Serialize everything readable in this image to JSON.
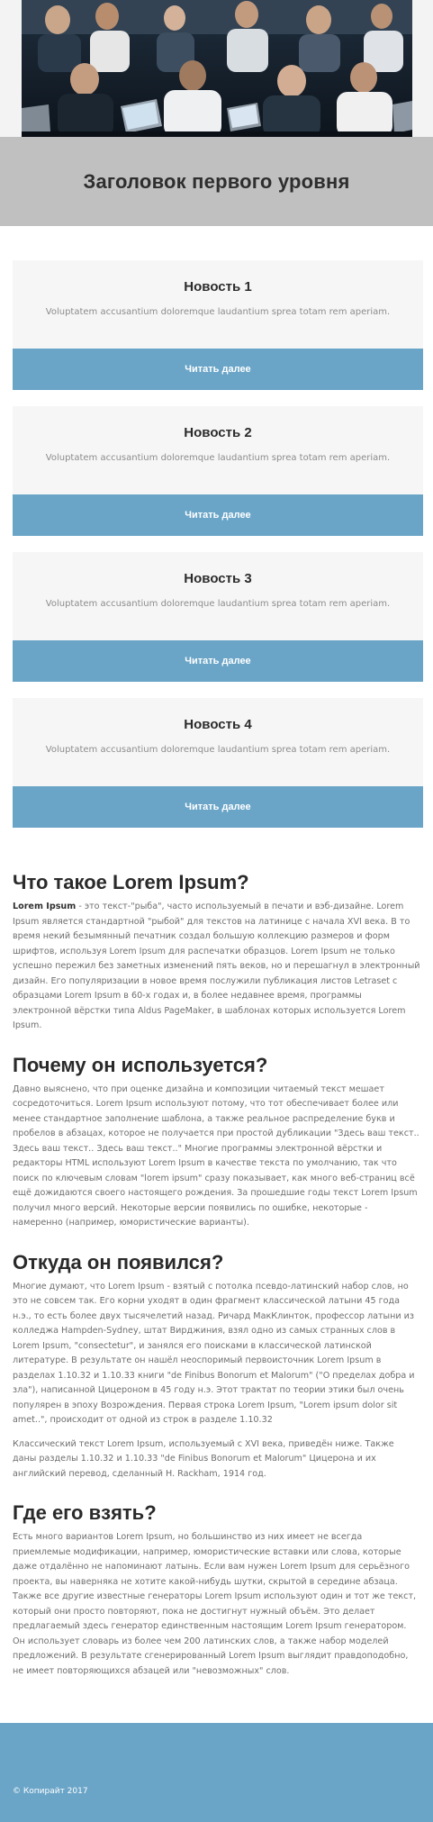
{
  "hero": {
    "image": "office-meeting-photo",
    "title": "Заголовок первого уровня"
  },
  "news": [
    {
      "title": "Новость 1",
      "text": "Voluptatem accusantium doloremque laudantium sprea totam rem aperiam.",
      "button": "Читать далее"
    },
    {
      "title": "Новость 2",
      "text": "Voluptatem accusantium doloremque laudantium sprea totam rem aperiam.",
      "button": "Читать далее"
    },
    {
      "title": "Новость 3",
      "text": "Voluptatem accusantium doloremque laudantium sprea totam rem aperiam.",
      "button": "Читать далее"
    },
    {
      "title": "Новость 4",
      "text": "Voluptatem accusantium doloremque laudantium sprea totam rem aperiam.",
      "button": "Читать далее"
    }
  ],
  "article": {
    "s1": {
      "heading": "Что такое Lorem Ipsum?",
      "lead": "Lorem Ipsum",
      "text": " - это текст-\"рыба\", часто используемый в печати и вэб-дизайне. Lorem Ipsum является стандартной \"рыбой\" для текстов на латинице с начала XVI века. В то время некий безымянный печатник создал большую коллекцию размеров и форм шрифтов, используя Lorem Ipsum для распечатки образцов. Lorem Ipsum не только успешно пережил без заметных изменений пять веков, но и перешагнул в электронный дизайн. Его популяризации в новое время послужили публикация листов Letraset с образцами Lorem Ipsum в 60-х годах и, в более недавнее время, программы электронной вёрстки типа Aldus PageMaker, в шаблонах которых используется Lorem Ipsum."
    },
    "s2": {
      "heading": "Почему он используется?",
      "text": "Давно выяснено, что при оценке дизайна и композиции читаемый текст мешает сосредоточиться. Lorem Ipsum используют потому, что тот обеспечивает более или менее стандартное заполнение шаблона, а также реальное распределение букв и пробелов в абзацах, которое не получается при простой дубликации \"Здесь ваш текст.. Здесь ваш текст.. Здесь ваш текст..\" Многие программы электронной вёрстки и редакторы HTML используют Lorem Ipsum в качестве текста по умолчанию, так что поиск по ключевым словам \"lorem ipsum\" сразу показывает, как много веб-страниц всё ещё дожидаются своего настоящего рождения. За прошедшие годы текст Lorem Ipsum получил много версий. Некоторые версии появились по ошибке, некоторые - намеренно (например, юмористические варианты)."
    },
    "s3": {
      "heading": "Откуда он появился?",
      "text": "Многие думают, что Lorem Ipsum - взятый с потолка псевдо-латинский набор слов, но это не совсем так. Его корни уходят в один фрагмент классической латыни 45 года н.э., то есть более двух тысячелетий назад. Ричард МакКлинток, профессор латыни из колледжа Hampden-Sydney, штат Вирджиния, взял одно из самых странных слов в Lorem Ipsum, \"consectetur\", и занялся его поисками в классической латинской литературе. В результате он нашёл неоспоримый первоисточник Lorem Ipsum в разделах 1.10.32 и 1.10.33 книги \"de Finibus Bonorum et Malorum\" (\"О пределах добра и зла\"), написанной Цицероном в 45 году н.э. Этот трактат по теории этики был очень популярен в эпоху Возрождения. Первая строка Lorem Ipsum, \"Lorem ipsum dolor sit amet..\", происходит от одной из строк в разделе 1.10.32",
      "text2": "Классический текст Lorem Ipsum, используемый с XVI века, приведён ниже. Также даны разделы 1.10.32 и 1.10.33 \"de Finibus Bonorum et Malorum\" Цицерона и их английский перевод, сделанный H. Rackham, 1914 год."
    },
    "s4": {
      "heading": "Где его взять?",
      "text": "Есть много вариантов Lorem Ipsum, но большинство из них имеет не всегда приемлемые модификации, например, юмористические вставки или слова, которые даже отдалённо не напоминают латынь. Если вам нужен Lorem Ipsum для серьёзного проекта, вы наверняка не хотите какой-нибудь шутки, скрытой в середине абзаца. Также все другие известные генераторы Lorem Ipsum используют один и тот же текст, который они просто повторяют, пока не достигнут нужный объём. Это делает предлагаемый здесь генератор единственным настоящим Lorem Ipsum генератором. Он использует словарь из более чем 200 латинских слов, а также набор моделей предложений. В результате сгенерированный Lorem Ipsum выглядит правдоподобно, не имеет повторяющихся абзацей или \"невозможных\" слов."
    }
  },
  "footer": {
    "copyright": "© Копирайт 2017"
  },
  "colors": {
    "accent": "#6aa5c8",
    "banner": "#c0c0c0",
    "card": "#f6f6f6"
  }
}
